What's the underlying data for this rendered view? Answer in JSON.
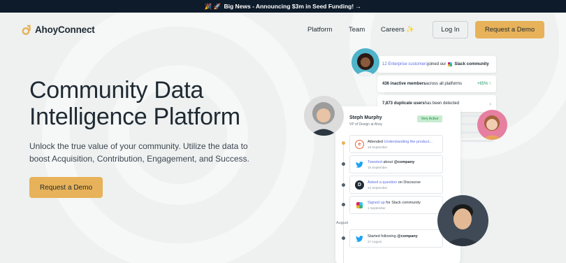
{
  "announcement": {
    "emoji": "🎉 🚀",
    "text": "Big News - Announcing $3m in Seed Funding! →"
  },
  "brand": {
    "name": "AhoyConnect",
    "accent": "#e7b259",
    "dark": "#0d1b2a"
  },
  "nav": {
    "platform": "Platform",
    "team": "Team",
    "careers": "Careers ✨",
    "login": "Log In",
    "request_demo": "Request a Demo"
  },
  "hero": {
    "title": "Community Data Intelligence Platform",
    "subtitle": "Unlock the true value of your community. Utilize the data to boost Acquisition, Contribution, Engagement, and Success.",
    "cta": "Request a Demo"
  },
  "notifications": {
    "n1": {
      "highlight": "12 Enterprise customers",
      "mid": " joined our ",
      "end": "Slack community"
    },
    "n2": {
      "bold": "436 inactive members",
      "rest": " across all platforms",
      "delta": "+65% ↑"
    },
    "n3": {
      "bold": "7,873 duplicate users",
      "rest": " has been detected"
    }
  },
  "profile": {
    "name": "Steph Murphy",
    "role": "VP of Design at Ahoy",
    "badge": "Very Active"
  },
  "activities": [
    {
      "lead": "Attended ",
      "link": "Understanding the product...",
      "date": "18 September"
    },
    {
      "link": "Tweeted",
      "lead2": " about ",
      "bold": "@company",
      "date": "16 September"
    },
    {
      "link": "Asked a question",
      "lead2": " on Discourse",
      "date": "12 September"
    },
    {
      "link": "Signed up",
      "lead2": " for Slack community",
      "date": "1 September"
    },
    {
      "lead": "Started following ",
      "bold": "@company",
      "date": "27 August"
    }
  ],
  "month_label": "August"
}
